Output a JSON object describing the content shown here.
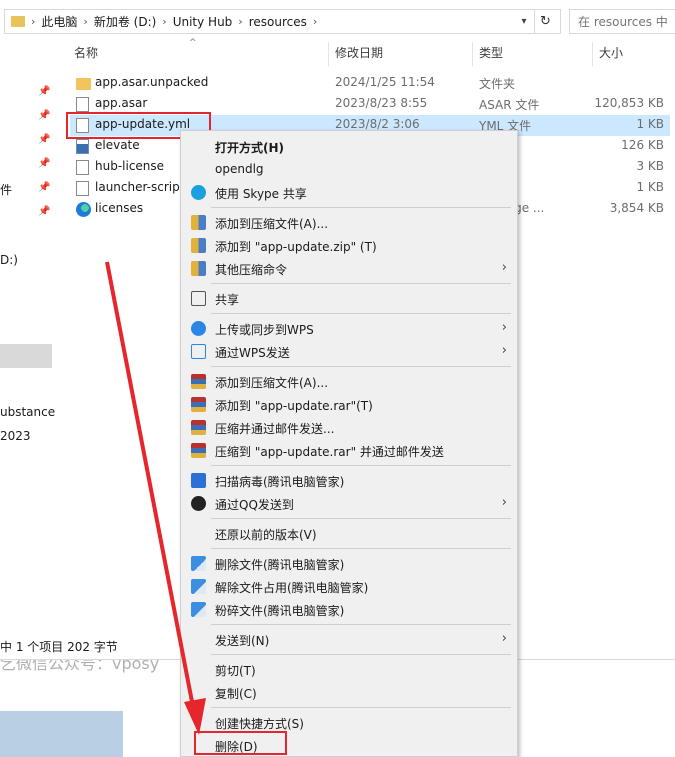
{
  "breadcrumb": [
    "此电脑",
    "新加卷 (D:)",
    "Unity Hub",
    "resources"
  ],
  "search": {
    "placeholder": "在 resources 中搜索"
  },
  "nav": {
    "items": [
      "件",
      "D:)",
      "ubstance",
      "2023"
    ]
  },
  "columns": {
    "name": "名称",
    "date": "修改日期",
    "type": "类型",
    "size": "大小"
  },
  "files": [
    {
      "name": "app.asar.unpacked",
      "date": "2024/1/25 11:54",
      "type": "文件夹",
      "size": "",
      "icon": "folder-icon"
    },
    {
      "name": "app.asar",
      "date": "2023/8/23 8:55",
      "type": "ASAR 文件",
      "size": "120,853 KB",
      "icon": "file-icon"
    },
    {
      "name": "app-update.yml",
      "date": "2023/8/2 3:06",
      "type": "YML 文件",
      "size": "1 KB",
      "icon": "file-icon"
    },
    {
      "name": "elevate",
      "date": "",
      "type": "序",
      "size": "126 KB",
      "icon": "exe-icon"
    },
    {
      "name": "hub-license",
      "date": "",
      "type": "",
      "size": "3 KB",
      "icon": "file-icon"
    },
    {
      "name": "launcher-script",
      "date": "",
      "type": "牛",
      "size": "1 KB",
      "icon": "file-icon"
    },
    {
      "name": "licenses",
      "date": "",
      "type": "oft Edge ...",
      "size": "3,854 KB",
      "icon": "edge-icon"
    }
  ],
  "status": {
    "text": "中 1 个项目  202 字节"
  },
  "watermark": {
    "text": "乞微信公众号：vposy"
  },
  "context_menu": {
    "open_with": "打开方式(H)",
    "opendlg": "opendlg",
    "skype_share": "使用 Skype 共享",
    "add_archive": "添加到压缩文件(A)...",
    "add_zip": "添加到 \"app-update.zip\" (T)",
    "other_compress": "其他压缩命令",
    "share": "共享",
    "wps_upload": "上传或同步到WPS",
    "wps_send": "通过WPS发送",
    "rar_add_archive": "添加到压缩文件(A)...",
    "rar_add": "添加到 \"app-update.rar\"(T)",
    "rar_email": "压缩并通过邮件发送...",
    "rar_email_named": "压缩到 \"app-update.rar\" 并通过邮件发送",
    "scan_virus": "扫描病毒(腾讯电脑管家)",
    "qq_send": "通过QQ发送到",
    "restore_prev": "还原以前的版本(V)",
    "tx_delete": "删除文件(腾讯电脑管家)",
    "tx_unlock": "解除文件占用(腾讯电脑管家)",
    "tx_shred": "粉碎文件(腾讯电脑管家)",
    "send_to": "发送到(N)",
    "cut": "剪切(T)",
    "copy": "复制(C)",
    "create_shortcut": "创建快捷方式(S)",
    "delete": "删除(D)"
  },
  "colors": {
    "selection": "#cce8ff",
    "highlight_red": "#e5262c",
    "menu_bg": "#f0f0f0"
  }
}
